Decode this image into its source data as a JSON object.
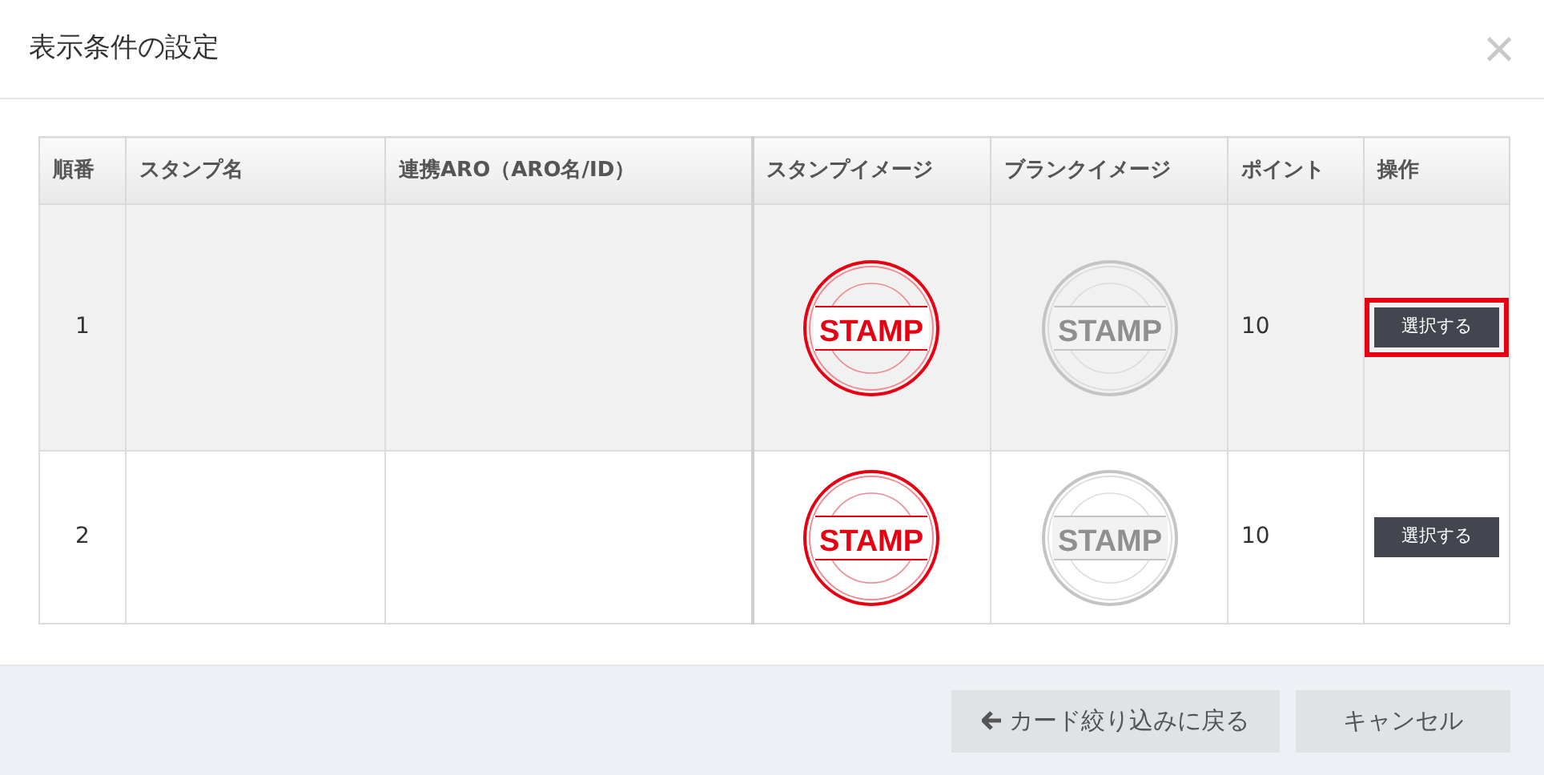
{
  "dialog": {
    "title": "表示条件の設定",
    "close": "×"
  },
  "table": {
    "columns": [
      "順番",
      "スタンプ名",
      "連携ARO（ARO名/ID）",
      "スタンプイメージ",
      "ブランクイメージ",
      "ポイント",
      "操作"
    ],
    "rows": [
      {
        "selected": true,
        "order": "1",
        "stamp_label": "STAMP",
        "blank_label": "STAMP",
        "points": "10",
        "action": "選択する",
        "annotated": true
      },
      {
        "selected": false,
        "order": "2",
        "stamp_label": "STAMP",
        "blank_label": "STAMP",
        "points": "10",
        "action": "選択する",
        "annotated": false
      }
    ]
  },
  "footer": {
    "buttons": [
      {
        "kind": "back",
        "label": "カード絞り込みに戻る"
      },
      {
        "kind": "cancel",
        "label": "キャンセル"
      }
    ]
  }
}
